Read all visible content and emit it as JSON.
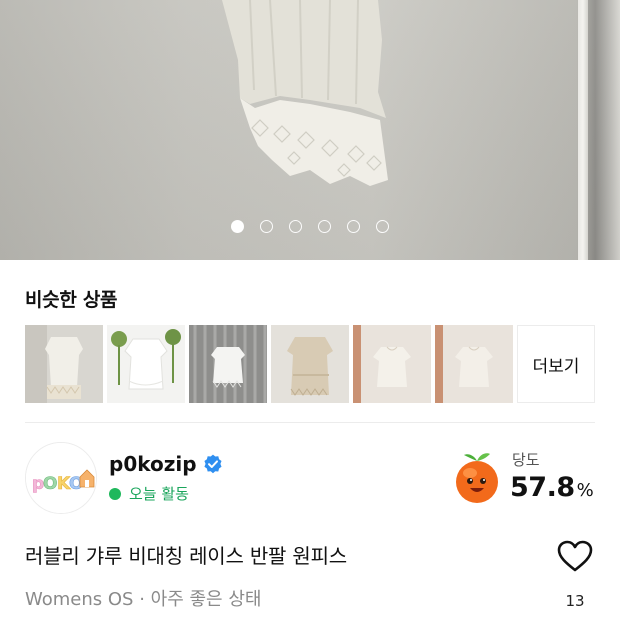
{
  "hero": {
    "page_count": 6,
    "current_page": 1
  },
  "similar": {
    "title": "비슷한 상품",
    "thumbnails": [
      "thumbnail-1",
      "thumbnail-2",
      "thumbnail-3",
      "thumbnail-4",
      "thumbnail-5",
      "thumbnail-6"
    ],
    "more_label": "더보기"
  },
  "seller": {
    "avatar_logo_text": "pOKO",
    "name": "p0kozip",
    "verified": true,
    "activity": "오늘 활동",
    "sweetness_label": "당도",
    "sweetness_value": "57.8",
    "sweetness_unit": "%"
  },
  "product": {
    "title": "러블리 갸루 비대칭 레이스 반팔 원피스",
    "meta": "Womens OS · 아주 좋은 상태",
    "like_count": "13"
  },
  "colors": {
    "accent_green": "#1fb85c",
    "verified_blue": "#2f8ff0",
    "peach": "#f26a1b"
  },
  "icons": {
    "verified": "verified-check-icon",
    "like": "heart-outline-icon",
    "sweetness": "peach-icon"
  }
}
